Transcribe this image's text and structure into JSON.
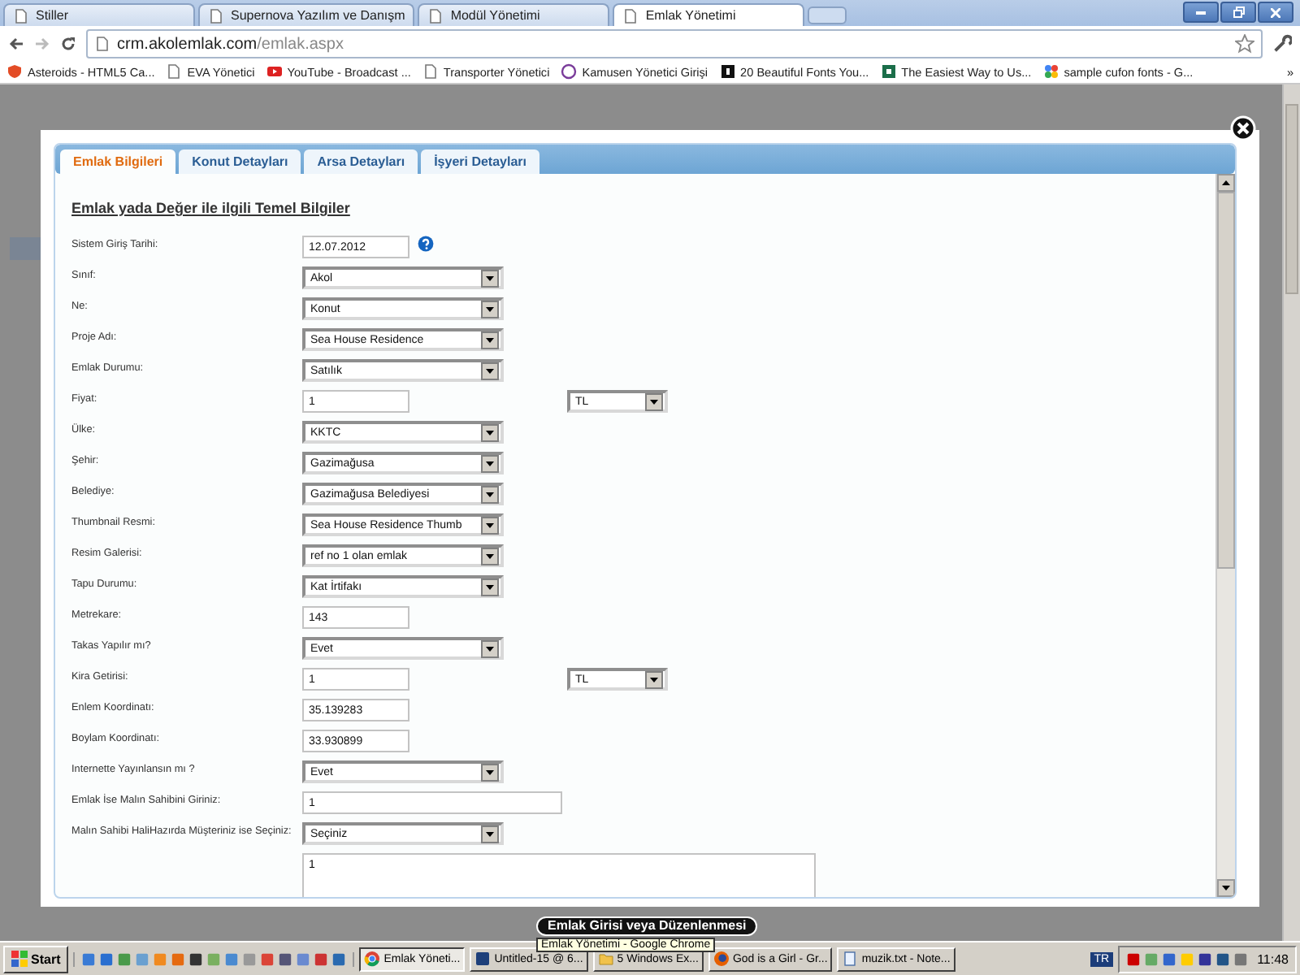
{
  "browser": {
    "tabs": [
      {
        "title": "Stiller",
        "selected": false
      },
      {
        "title": "Supernova Yazılım ve Danışm",
        "selected": false
      },
      {
        "title": "Modül Yönetimi",
        "selected": false
      },
      {
        "title": "Emlak Yönetimi",
        "selected": true
      }
    ],
    "address": {
      "host": "crm.akolemlak.com",
      "path": "/emlak.aspx"
    },
    "bookmarks": [
      {
        "label": "Asteroids - HTML5 Ca...",
        "kind": "shield"
      },
      {
        "label": "EVA Yönetici",
        "kind": "page"
      },
      {
        "label": "YouTube - Broadcast ...",
        "kind": "play"
      },
      {
        "label": "Transporter Yönetici",
        "kind": "page"
      },
      {
        "label": "Kamusen Yönetici Girişi",
        "kind": "ring"
      },
      {
        "label": "20 Beautiful Fonts You...",
        "kind": "square"
      },
      {
        "label": "The Easiest Way to Us...",
        "kind": "leaf"
      },
      {
        "label": "sample cufon fonts - G...",
        "kind": "dots"
      }
    ],
    "overflow": "»"
  },
  "modal": {
    "tabs": [
      {
        "label": "Emlak Bilgileri",
        "selected": true
      },
      {
        "label": "Konut Detayları",
        "selected": false
      },
      {
        "label": "Arsa Detayları",
        "selected": false
      },
      {
        "label": "İşyeri Detayları",
        "selected": false
      }
    ],
    "heading": "Emlak yada Değer ile ilgili Temel Bilgiler",
    "fields": [
      {
        "label": "Sistem Giriş Tarihi:",
        "kind": "text",
        "value": "12.07.2012",
        "help": true
      },
      {
        "label": "Sınıf:",
        "kind": "select",
        "value": "Akol"
      },
      {
        "label": "Ne:",
        "kind": "select",
        "value": "Konut"
      },
      {
        "label": "Proje Adı:",
        "kind": "select",
        "value": "Sea House Residence"
      },
      {
        "label": "Emlak Durumu:",
        "kind": "select",
        "value": "Satılık"
      },
      {
        "label": "Fiyat:",
        "kind": "text",
        "value": "1",
        "currency": "TL"
      },
      {
        "label": "Ülke:",
        "kind": "select",
        "value": "KKTC"
      },
      {
        "label": "Şehir:",
        "kind": "select",
        "value": "Gazimağusa"
      },
      {
        "label": "Belediye:",
        "kind": "select",
        "value": "Gazimağusa Belediyesi"
      },
      {
        "label": "Thumbnail Resmi:",
        "kind": "select",
        "value": "Sea House Residence Thumb"
      },
      {
        "label": "Resim Galerisi:",
        "kind": "select",
        "value": "ref no 1 olan emlak"
      },
      {
        "label": "Tapu Durumu:",
        "kind": "select",
        "value": "Kat İrtifakı"
      },
      {
        "label": "Metrekare:",
        "kind": "text",
        "value": "143"
      },
      {
        "label": "Takas Yapılır mı?",
        "kind": "select",
        "value": "Evet"
      },
      {
        "label": "Kira Getirisi:",
        "kind": "text",
        "value": "1",
        "currency": "TL"
      },
      {
        "label": "Enlem Koordinatı:",
        "kind": "text",
        "value": "35.139283"
      },
      {
        "label": "Boylam Koordinatı:",
        "kind": "text",
        "value": "33.930899"
      },
      {
        "label": "Internette Yayınlansın mı ?",
        "kind": "select",
        "value": "Evet"
      },
      {
        "label": "Emlak İse Malın Sahibini Giriniz:",
        "kind": "wide",
        "value": "1"
      },
      {
        "label": "Malın Sahibi HaliHazırda Müşteriniz ise Seçiniz:",
        "kind": "select",
        "value": "Seçiniz"
      },
      {
        "kind": "textarea",
        "value": "1"
      }
    ]
  },
  "tooltips": {
    "title": "Emlak Girisi veya Düzenlenmesi",
    "window": "Emlak Yönetimi - Google Chrome"
  },
  "taskbar": {
    "start": "Start",
    "tasks": [
      {
        "label": "Emlak Yöneti...",
        "kind": "chrome",
        "selected": true
      },
      {
        "label": "Untitled-15 @ 6...",
        "kind": "ps",
        "selected": false
      },
      {
        "label": "5 Windows Ex...",
        "kind": "folder",
        "selected": false
      },
      {
        "label": "God is a Girl - Gr...",
        "kind": "firefox",
        "selected": false
      },
      {
        "label": "muzik.txt - Note...",
        "kind": "notepad",
        "selected": false
      }
    ],
    "language": "TR",
    "clock": "11:48"
  }
}
